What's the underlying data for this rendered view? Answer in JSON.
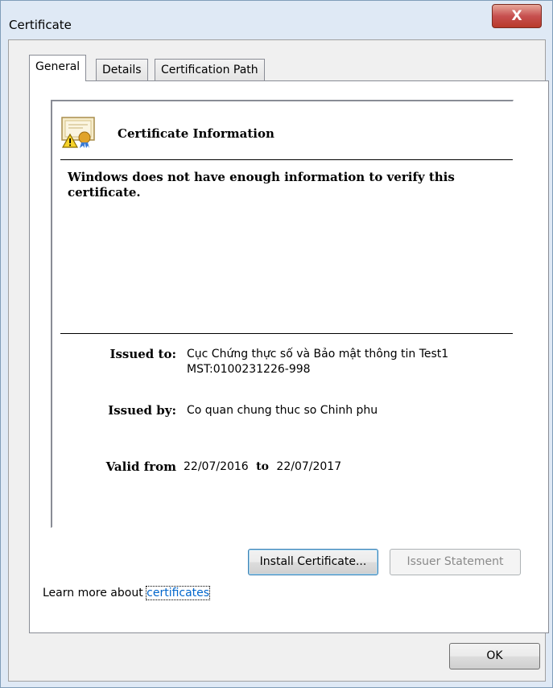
{
  "window": {
    "title": "Certificate",
    "close_glyph": "X"
  },
  "tabs": [
    {
      "label": "General",
      "active": true
    },
    {
      "label": "Details",
      "active": false
    },
    {
      "label": "Certification Path",
      "active": false
    }
  ],
  "info": {
    "icon": "certificate-warning-icon",
    "heading": "Certificate Information",
    "warning": "Windows does not have enough information to verify this certificate.",
    "issued_to_label": "Issued to:",
    "issued_to_line1": "Cục Chứng thực số và Bảo mật thông tin Test1",
    "issued_to_line2": "MST:0100231226-998",
    "issued_by_label": "Issued by:",
    "issued_by_value": "Co quan chung thuc so Chinh phu",
    "valid_from_label": "Valid from",
    "valid_from": "22/07/2016",
    "to_label": "to",
    "valid_to": "22/07/2017"
  },
  "buttons": {
    "install": "Install Certificate...",
    "issuer": "Issuer Statement",
    "ok": "OK"
  },
  "learn_more": {
    "prefix": "Learn more about ",
    "link": "certificates"
  },
  "colors": {
    "link": "#0066cc",
    "close_button": "#c75050"
  }
}
